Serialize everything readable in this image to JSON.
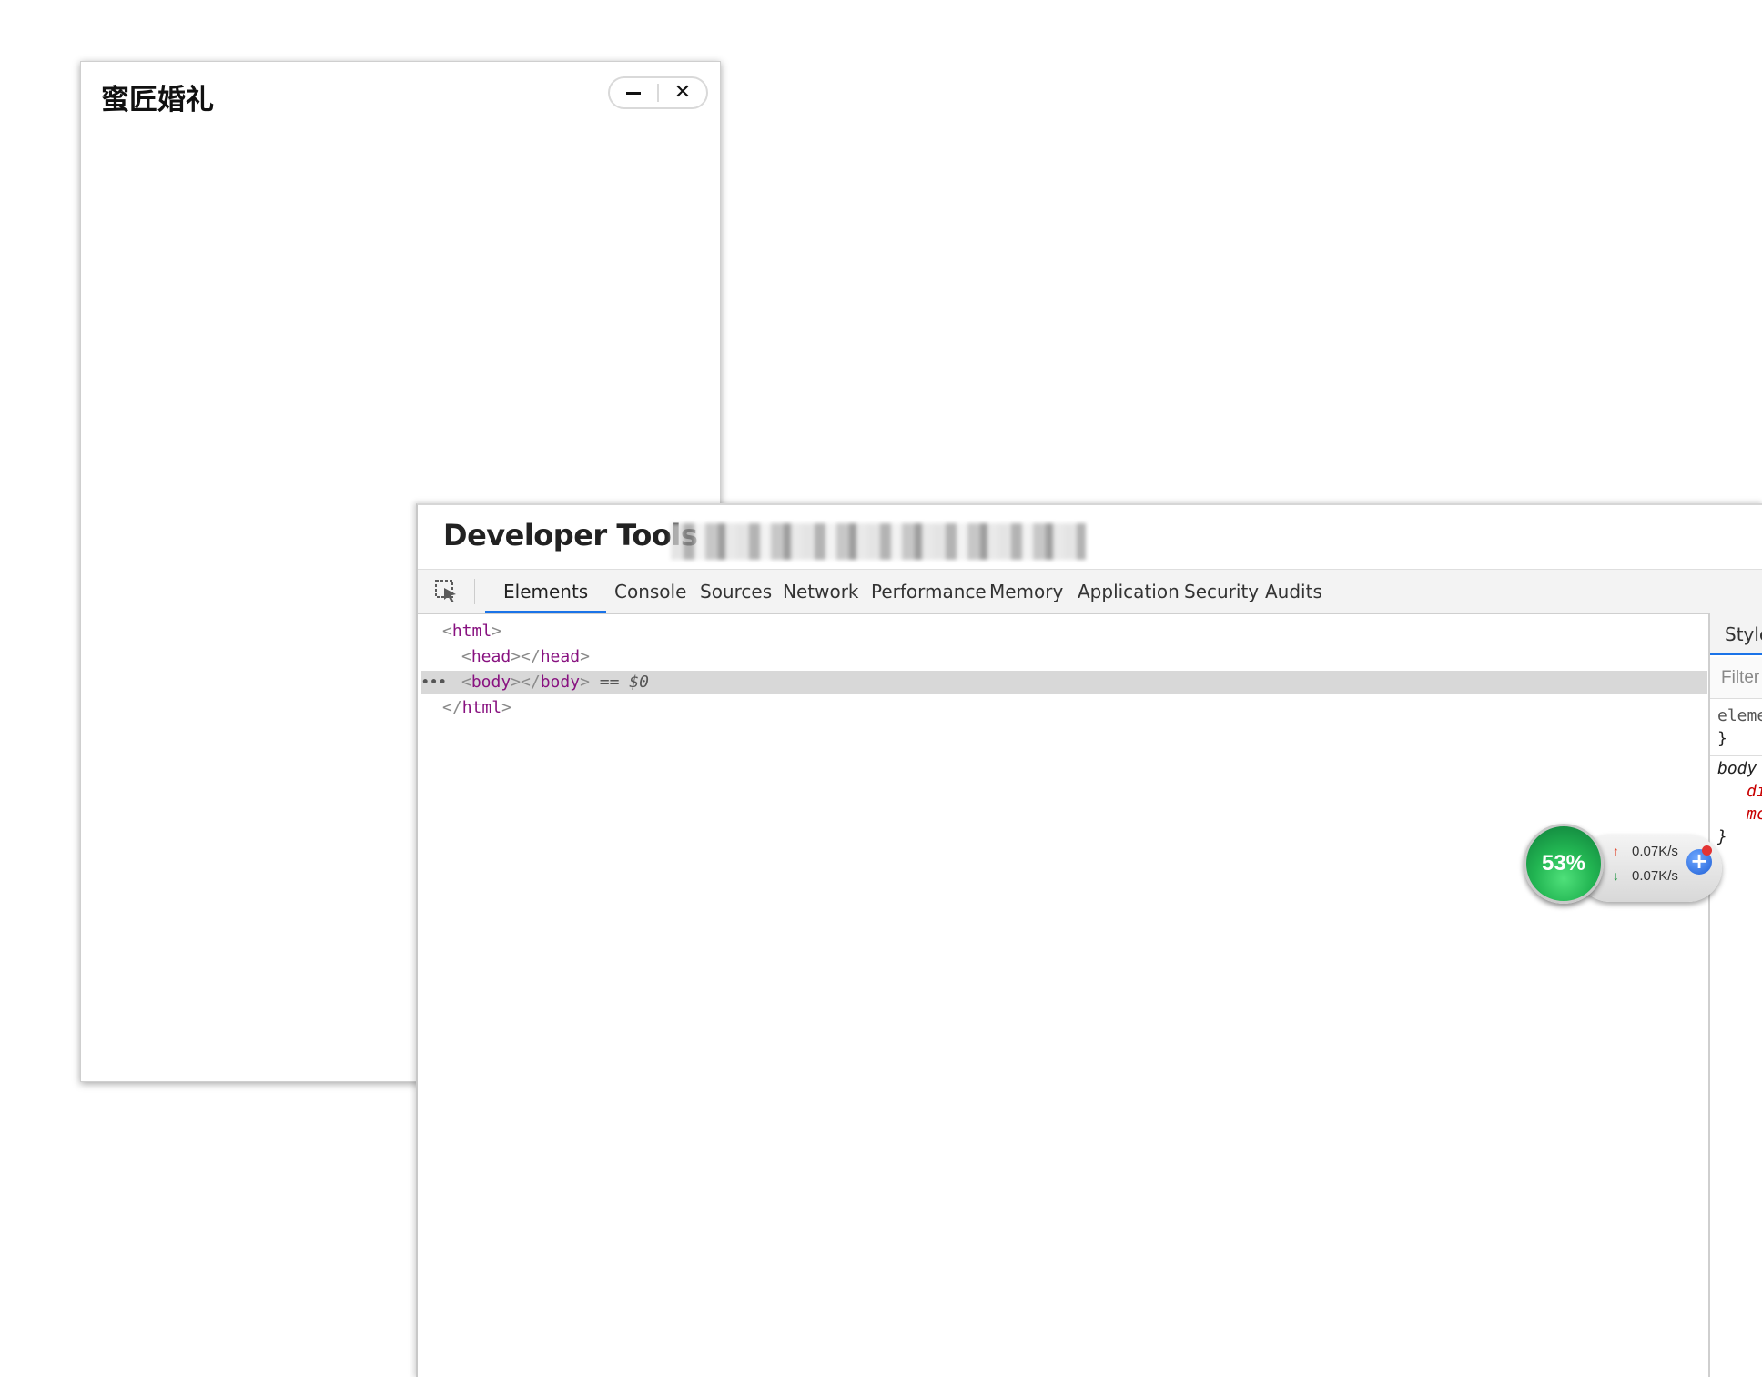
{
  "app_window": {
    "title": "蜜匠婚礼",
    "capsule": {
      "minimize_icon": "minus-icon",
      "close_icon": "close-icon",
      "close_glyph": "✕"
    }
  },
  "devtools": {
    "title": "Developer Tools",
    "tabs": [
      "Elements",
      "Console",
      "Sources",
      "Network",
      "Performance",
      "Memory",
      "Application",
      "Security",
      "Audits"
    ],
    "active_tab": "Elements",
    "dom_tree": {
      "line1": {
        "open": "<",
        "tag": "html",
        "close": ">"
      },
      "line2": {
        "open": "<",
        "tag_open": "head",
        "mid": "></",
        "tag_close": "head",
        "close": ">"
      },
      "line3": {
        "dots": "•••",
        "open": "<",
        "tag_open": "body",
        "mid": "></",
        "tag_close": "body",
        "close": ">",
        "suffix": " == $0"
      },
      "line4": {
        "open": "</",
        "tag": "html",
        "close": ">"
      }
    },
    "styles": {
      "tab_label": "Style",
      "filter_placeholder": "Filter",
      "rule1_selector": "eleme",
      "rule1_close": "}",
      "rule2_selector": "body",
      "rule2_prop1": "di",
      "rule2_prop2": "mc",
      "rule2_close": "}"
    }
  },
  "net_monitor": {
    "percent": "53%",
    "upload": "0.07K/s",
    "download": "0.07K/s",
    "up_arrow": "↑",
    "down_arrow": "↓",
    "plus": "+"
  },
  "colors": {
    "active_tab_underline": "#1a73e8",
    "tag_color": "#881280",
    "selected_row_bg": "#d8d8d8",
    "ball_green": "#22b552"
  }
}
